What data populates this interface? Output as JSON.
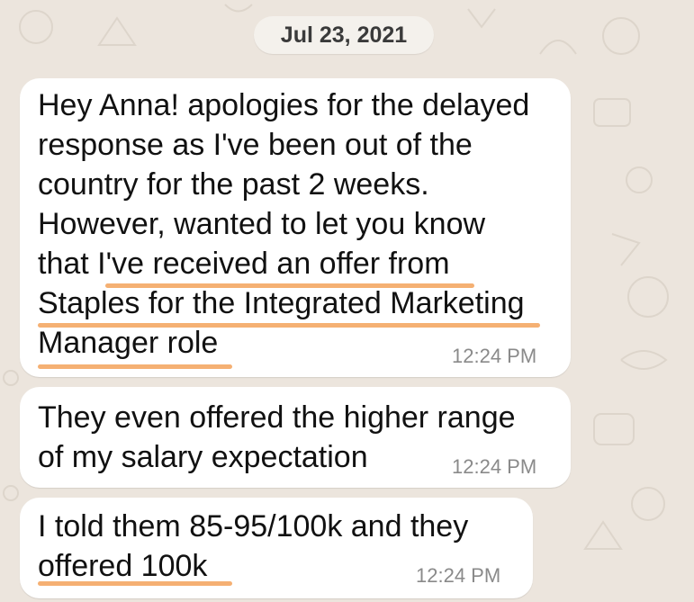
{
  "date_separator": "Jul 23, 2021",
  "messages": [
    {
      "lines": [
        "Hey Anna! apologies for the delayed",
        "response as I've been out of the",
        "country for the past 2 weeks.",
        "However, wanted to let you know",
        "that I've received an offer from",
        "Staples for the Integrated Marketing",
        "Manager role"
      ],
      "time": "12:24 PM"
    },
    {
      "lines": [
        "They even offered the higher range",
        "of my salary expectation"
      ],
      "time": "12:24 PM"
    },
    {
      "lines": [
        "I told them 85-95/100k and they",
        "offered 100k"
      ],
      "time": "12:24 PM"
    }
  ],
  "colors": {
    "wallpaper": "#ece5dd",
    "bubble": "#ffffff",
    "highlight_underline": "#f5b073",
    "timestamp": "#8a8a8a"
  },
  "icons": [
    "wallpaper-doodle-icons"
  ]
}
